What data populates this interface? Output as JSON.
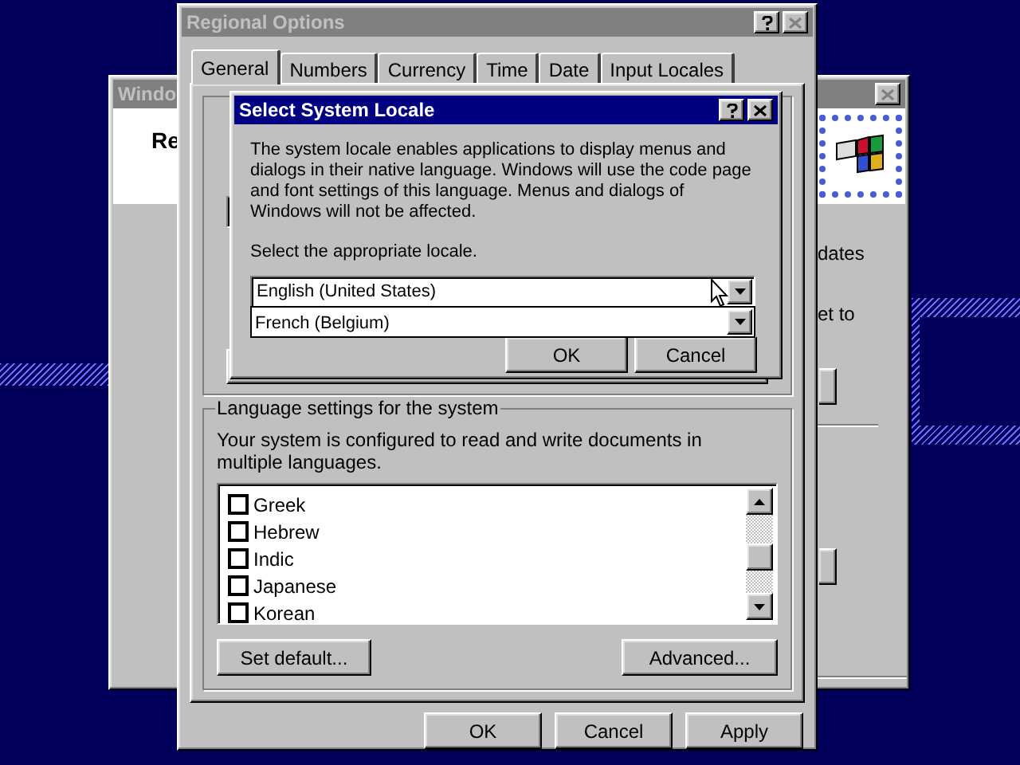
{
  "back_window": {
    "title": "Windo",
    "heading": "Re",
    "text_1": "dates",
    "text_2": "et to"
  },
  "regional_options": {
    "title": "Regional Options",
    "tabs": [
      {
        "label": "General",
        "selected": true
      },
      {
        "label": "Numbers",
        "selected": false
      },
      {
        "label": "Currency",
        "selected": false
      },
      {
        "label": "Time",
        "selected": false
      },
      {
        "label": "Date",
        "selected": false
      },
      {
        "label": "Input Locales",
        "selected": false
      }
    ],
    "language_group": {
      "label": "Language settings for the system",
      "description": "Your system is configured to read and write documents in multiple languages.",
      "languages": [
        {
          "label": "Greek",
          "checked": false
        },
        {
          "label": "Hebrew",
          "checked": false
        },
        {
          "label": "Indic",
          "checked": false
        },
        {
          "label": "Japanese",
          "checked": false
        },
        {
          "label": "Korean",
          "checked": false
        }
      ],
      "buttons": [
        "Set default...",
        "Advanced..."
      ]
    },
    "buttons": [
      "OK",
      "Cancel",
      "Apply"
    ]
  },
  "locale_dialog": {
    "title": "Select System Locale",
    "description": "The system locale enables applications to display menus and dialogs in their native language.  Windows will use the code page and font settings of this language.  Menus and dialogs of Windows will not be affected.",
    "prompt": "Select the appropriate locale.",
    "locale_combo": {
      "value": "English (United States)",
      "expanded": true
    },
    "dropdown_items": [
      "French (Belgium)"
    ],
    "buttons": [
      "OK",
      "Cancel"
    ]
  }
}
